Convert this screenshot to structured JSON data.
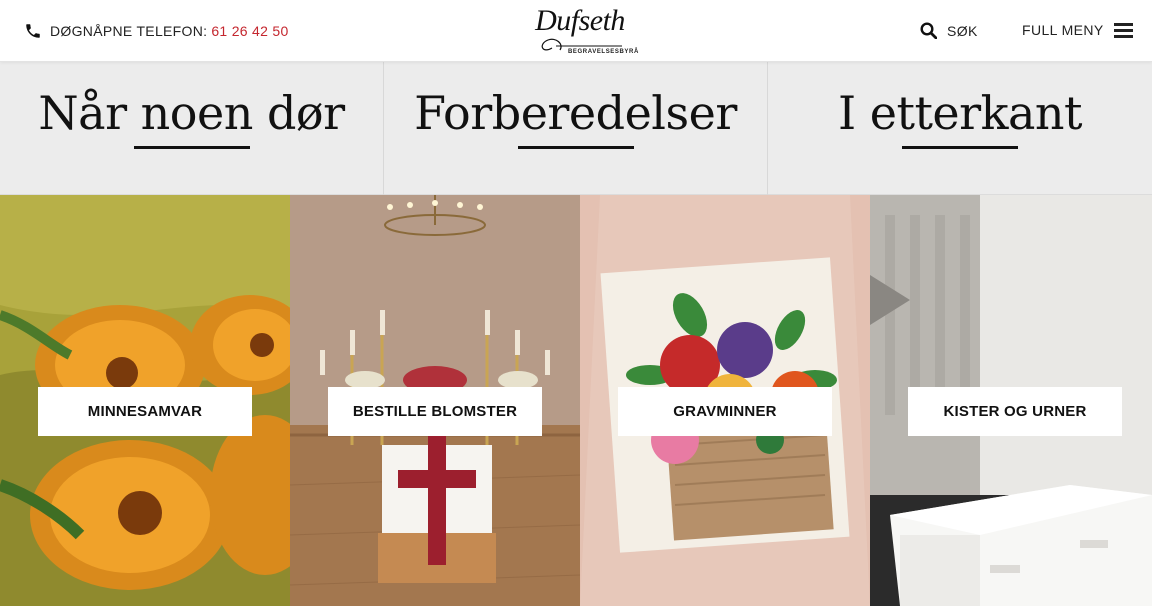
{
  "header": {
    "phone_label": "DØGNÅPNE TELEFON:",
    "phone_number": "61 26 42 50",
    "logo_name": "Dufseth",
    "logo_sub": "BEGRAVELSESBYRÅ",
    "search_label": "SØK",
    "menu_label": "FULL MENY"
  },
  "categories": [
    {
      "title": "Når noen dør"
    },
    {
      "title": "Forberedelser"
    },
    {
      "title": "I etterkant"
    }
  ],
  "tiles": [
    {
      "label": "MINNESAMVAR",
      "image": "orange-gerbera-flowers"
    },
    {
      "label": "BESTILLE BLOMSTER",
      "image": "chapel-coffin-with-flower-cross"
    },
    {
      "label": "GRAVMINNER",
      "image": "paper-roses-card"
    },
    {
      "label": "KISTER OG URNER",
      "image": "white-coffin"
    }
  ],
  "colors": {
    "accent_red": "#c4262e",
    "strip_bg": "#ececec"
  }
}
